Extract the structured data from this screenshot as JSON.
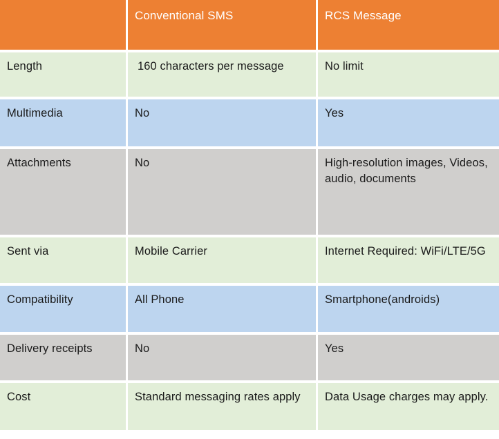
{
  "table": {
    "columns": [
      {
        "key": "feature",
        "header": ""
      },
      {
        "key": "sms",
        "header": "Conventional SMS"
      },
      {
        "key": "rcs",
        "header": "RCS Message"
      }
    ],
    "colors": {
      "header_background": "#ed8033",
      "header_text": "#ffffff",
      "band_green": "#e2eed8",
      "band_blue": "#bdd5ef",
      "band_gray": "#d0cfcd",
      "body_text": "#1a1a1a",
      "gridline": "#ffffff"
    },
    "rows": [
      {
        "feature": "Length",
        "sms": " 160 characters per message",
        "rcs": "No limit",
        "band": "green"
      },
      {
        "feature": "Multimedia",
        "sms": "No",
        "rcs": "Yes",
        "band": "blue"
      },
      {
        "feature": "Attachments",
        "sms": "No",
        "rcs": "High-resolution images, Videos, audio, documents",
        "band": "gray"
      },
      {
        "feature": "Sent via",
        "sms": "Mobile Carrier",
        "rcs": "Internet Required: WiFi/LTE/5G",
        "band": "green"
      },
      {
        "feature": "Compatibility",
        "sms": "All Phone",
        "rcs": "Smartphone(androids)",
        "band": "blue"
      },
      {
        "feature": "Delivery receipts",
        "sms": "No",
        "rcs": "Yes",
        "band": "gray"
      },
      {
        "feature": "Cost",
        "sms": "Standard messaging rates apply",
        "rcs": "Data Usage charges may apply.",
        "band": "green"
      }
    ]
  }
}
